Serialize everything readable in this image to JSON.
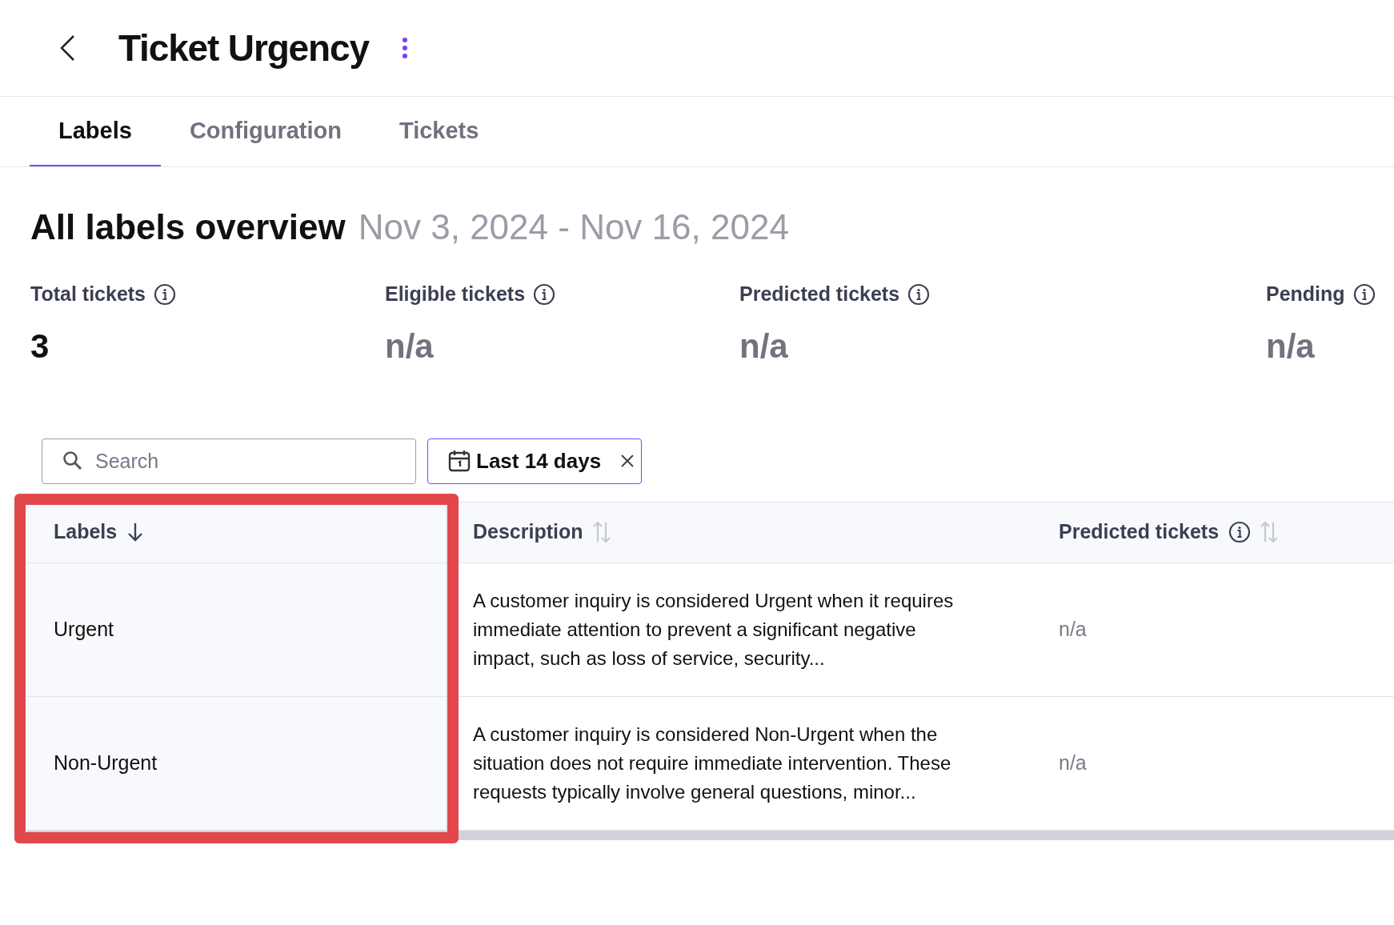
{
  "header": {
    "title": "Ticket Urgency"
  },
  "tabs": [
    {
      "label": "Labels",
      "selected": true
    },
    {
      "label": "Configuration",
      "selected": false
    },
    {
      "label": "Tickets",
      "selected": false
    }
  ],
  "overview": {
    "title": "All labels overview",
    "date_range": "Nov 3, 2024 - Nov 16, 2024",
    "stats": [
      {
        "label": "Total tickets",
        "value": "3",
        "available": true
      },
      {
        "label": "Eligible tickets",
        "value": "n/a",
        "available": false
      },
      {
        "label": "Predicted tickets",
        "value": "n/a",
        "available": false
      },
      {
        "label": "Pending",
        "value": "n/a",
        "available": false
      }
    ]
  },
  "search": {
    "placeholder": "Search"
  },
  "date_filter": {
    "label": "Last 14 days"
  },
  "table": {
    "columns": [
      {
        "label": "Labels",
        "sorted": true,
        "info": false
      },
      {
        "label": "Description",
        "sorted": false,
        "info": false
      },
      {
        "label": "Predicted tickets",
        "sorted": false,
        "info": true
      }
    ],
    "rows": [
      {
        "label": "Urgent",
        "description": "A customer inquiry is considered Urgent when it requires immediate attention to prevent a significant negative impact, such as loss of service, security...",
        "predicted": "n/a"
      },
      {
        "label": "Non-Urgent",
        "description": "A customer inquiry is considered Non-Urgent when the situation does not require immediate intervention. These requests typically involve general questions, minor...",
        "predicted": "n/a"
      }
    ]
  }
}
